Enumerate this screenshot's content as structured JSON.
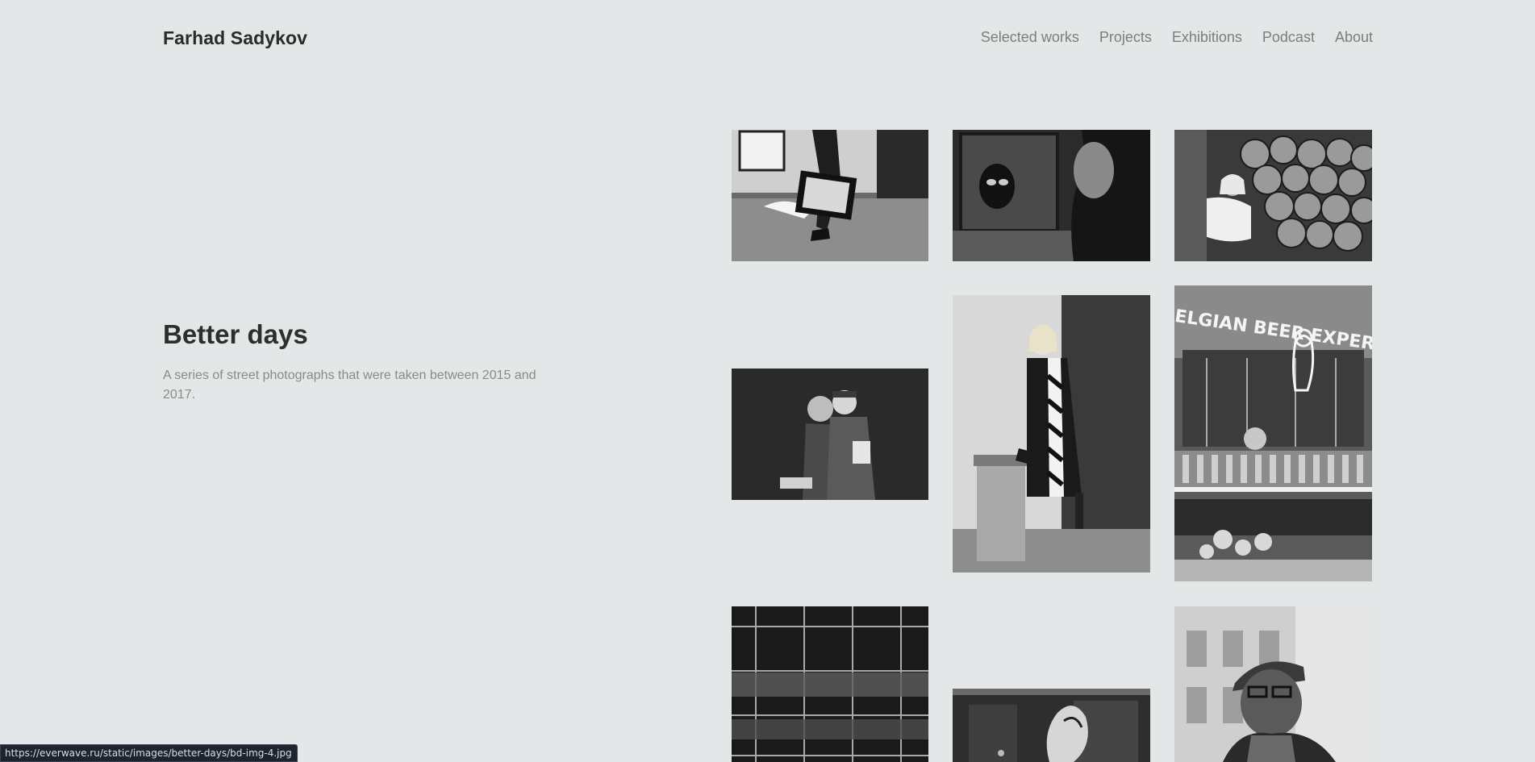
{
  "header": {
    "brand": "Farhad Sadykov",
    "nav": [
      "Selected works",
      "Projects",
      "Exhibitions",
      "Podcast",
      "About"
    ]
  },
  "project": {
    "title": "Better days",
    "description": "A series of street photographs that were taken between 2015 and 2017."
  },
  "gallery": {
    "photos": [
      "man-carrying-painting",
      "balaclava-figure-and-passerby",
      "woman-with-cabbages",
      "elderly-couple-on-bench",
      "young-woman-with-striped-scarf",
      "belgian-beer-expert-window",
      "scaffolding-building",
      "graffiti-wall",
      "man-with-flat-cap-and-glasses"
    ],
    "sign_text": "BELGIAN BEER EXPERT"
  },
  "status_bar": {
    "url": "https://everwave.ru/static/images/better-days/bd-img-4.jpg"
  }
}
